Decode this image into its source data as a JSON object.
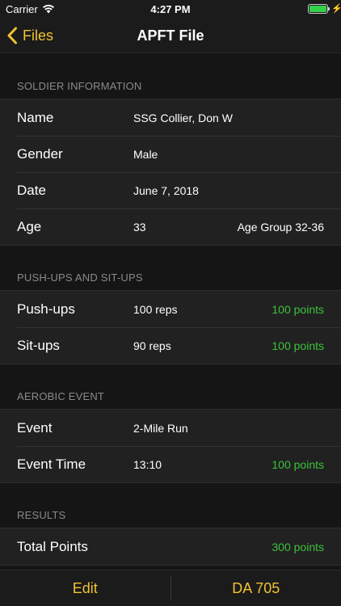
{
  "status_bar": {
    "carrier": "Carrier",
    "time": "4:27 PM",
    "battery_level": 1.0,
    "battery_color": "#33d14a"
  },
  "nav": {
    "back_label": "Files",
    "title": "APFT File",
    "accent_color": "#f2c230"
  },
  "sections": {
    "soldier": {
      "header": "SOLDIER INFORMATION",
      "name": {
        "label": "Name",
        "value": "SSG Collier, Don W"
      },
      "gender": {
        "label": "Gender",
        "value": "Male"
      },
      "date": {
        "label": "Date",
        "value": "June 7, 2018"
      },
      "age": {
        "label": "Age",
        "value": "33",
        "detail": "Age Group 32-36"
      }
    },
    "pushups_situps": {
      "header": "PUSH-UPS AND SIT-UPS",
      "pushups": {
        "label": "Push-ups",
        "value": "100 reps",
        "detail": "100 points"
      },
      "situps": {
        "label": "Sit-ups",
        "value": "90 reps",
        "detail": "100 points"
      }
    },
    "aerobic": {
      "header": "AEROBIC EVENT",
      "event": {
        "label": "Event",
        "value": "2-Mile Run"
      },
      "event_time": {
        "label": "Event Time",
        "value": "13:10",
        "detail": "100 points"
      }
    },
    "results": {
      "header": "RESULTS",
      "total_points": {
        "label": "Total Points",
        "detail": "300 points"
      }
    }
  },
  "toolbar": {
    "edit_label": "Edit",
    "form_label": "DA 705"
  },
  "points_color": "#3cc23a"
}
